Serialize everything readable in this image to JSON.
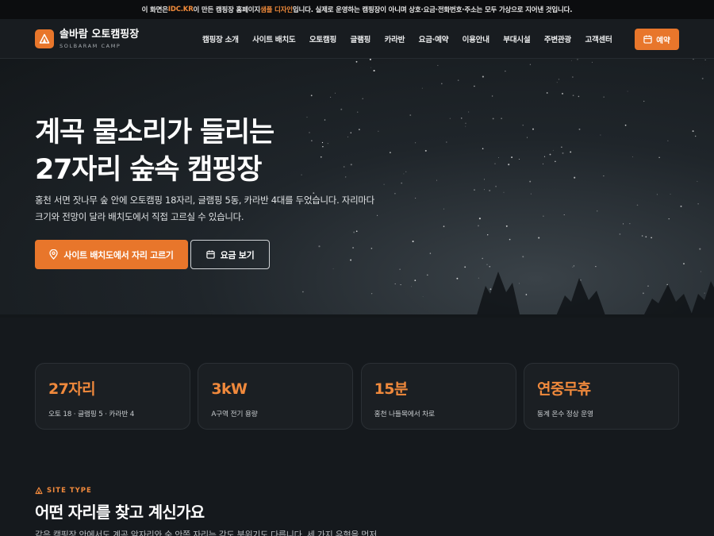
{
  "notice": {
    "prefix": "이 화면은 ",
    "brand": "IDC.KR",
    "middle": " 이 만든 캠핑장 홈페이지 ",
    "sample": "샘플 디자인",
    "suffix": "입니다. 실제로 운영하는 캠핑장이 아니며 상호·요금·전화번호·주소는 모두 가상으로 지어낸 것입니다."
  },
  "brand": {
    "name": "솔바람 오토캠핑장",
    "sub": "SOLBARAM CAMP",
    "icon": "tent-icon"
  },
  "nav": {
    "items": [
      "캠핑장 소개",
      "사이트 배치도",
      "오토캠핑",
      "글램핑",
      "카라반",
      "요금·예약",
      "이용안내",
      "부대시설",
      "주변관광",
      "고객센터"
    ],
    "reserve_label": "예약"
  },
  "hero": {
    "title_line1": "계곡 물소리가 들리는",
    "title_line2": "27자리 숲속 캠핑장",
    "desc_line1": "홍천 서면 잣나무 숲 안에 오토캠핑 18자리, 글램핑 5동, 카라반 4대를 두었습니다. 자리마다",
    "desc_line2": "크기와 전망이 달라 배치도에서 직접 고르실 수 있습니다.",
    "primary_button": "사이트 배치도에서 자리 고르기",
    "secondary_button": "요금 보기"
  },
  "stats": [
    {
      "value": "27자리",
      "label": "오토 18 · 글램핑 5 · 카라반 4"
    },
    {
      "value": "3kW",
      "label": "A구역 전기 용량"
    },
    {
      "value": "15분",
      "label": "홍천 나들목에서 차로"
    },
    {
      "value": "연중무휴",
      "label": "동계 온수 정상 운영"
    }
  ],
  "section": {
    "eyebrow": "SITE TYPE",
    "title": "어떤 자리를 찾고 계신가요",
    "desc": "같은 캠핑장 안에서도 계곡 앞자리와 숲 안쪽 자리는 각도 분위기도 다릅니다. 세 가지 유형을 먼저"
  },
  "colors": {
    "accent": "#e8762b",
    "accent_text": "#f0893c",
    "background": "#15191d",
    "card": "#1b1f23"
  }
}
